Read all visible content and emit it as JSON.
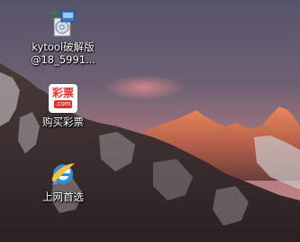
{
  "desktop": {
    "icons": [
      {
        "label_line1": "kytool破解版",
        "label_line2": "@18_5991...",
        "icon": "installer-cd-icon"
      },
      {
        "label": "购买彩票",
        "icon": "lottery-icon",
        "badge_text": "彩票",
        "badge_sub": ".com"
      },
      {
        "label": "上网首选",
        "icon": "internet-explorer-icon"
      }
    ]
  },
  "colors": {
    "sky_top": "#5b5869",
    "sky_glow": "#c88a8c",
    "mountain_dark": "#3a3032",
    "peak_lit": "#e07a4a"
  }
}
